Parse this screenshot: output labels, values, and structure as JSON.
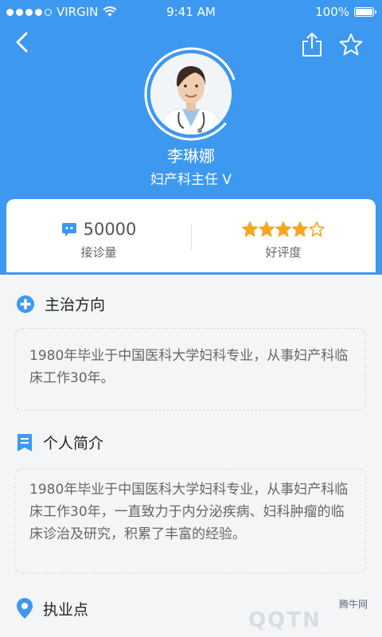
{
  "status_bar": {
    "carrier": "VIRGIN",
    "time": "9:41 AM",
    "battery": "100%"
  },
  "doctor": {
    "name": "李琳娜",
    "title": "妇产科主任 V"
  },
  "stats": {
    "consultations": {
      "value": "50000",
      "label": "接诊量"
    },
    "rating": {
      "label": "好评度",
      "stars_filled": 4,
      "stars_total": 5
    }
  },
  "sections": {
    "specialty": {
      "title": "主治方向",
      "text": "1980年毕业于中国医科大学妇科专业，从事妇产科临床工作30年。"
    },
    "bio": {
      "title": "个人简介",
      "text": "1980年毕业于中国医科大学妇科专业，从事妇产科临床工作30年，一直致力于内分泌疾病、妇科肿瘤的临床诊治及研究，积累了丰富的经验。"
    },
    "practice": {
      "title": "执业点"
    }
  },
  "watermark": {
    "site": "腾牛网",
    "logo": "QQTN"
  },
  "colors": {
    "primary": "#3d98f0",
    "star": "#f5a623"
  }
}
